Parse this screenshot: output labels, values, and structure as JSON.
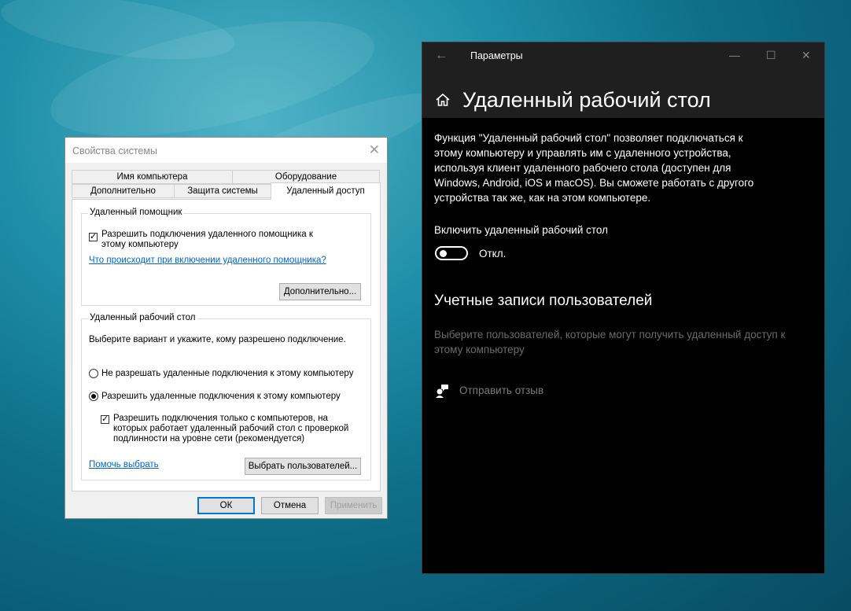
{
  "dialog": {
    "title": "Свойства системы",
    "tabs_row1": [
      "Имя компьютера",
      "Оборудование"
    ],
    "tabs_row2": [
      "Дополнительно",
      "Защита системы",
      "Удаленный доступ"
    ],
    "remote_assistance": {
      "group_title": "Удаленный помощник",
      "allow_checkbox_label": "Разрешить подключения удаленного помощника к этому компьютеру",
      "allow_checked": true,
      "help_link": "Что происходит при включении удаленного помощника?",
      "advanced_button": "Дополнительно..."
    },
    "remote_desktop": {
      "group_title": "Удаленный рабочий стол",
      "instruction": "Выберите вариант и укажите, кому разрешено подключение.",
      "option_deny": "Не разрешать удаленные подключения к этому компьютеру",
      "option_allow": "Разрешить удаленные подключения к этому компьютеру",
      "selected_option": "allow",
      "nla_checkbox_label": "Разрешить подключения только с компьютеров, на которых работает удаленный рабочий стол с проверкой подлинности на уровне сети (рекомендуется)",
      "nla_checked": true,
      "help_link": "Помочь выбрать",
      "select_users_button": "Выбрать пользователей..."
    },
    "buttons": {
      "ok": "ОК",
      "cancel": "Отмена",
      "apply": "Применить"
    }
  },
  "settings": {
    "window_title": "Параметры",
    "heading": "Удаленный рабочий стол",
    "description": "Функция \"Удаленный рабочий стол\" позволяет подключаться к этому компьютеру и управлять им с удаленного устройства, используя клиент удаленного рабочего стола (доступен для Windows, Android, iOS и macOS). Вы сможете работать с другого устройства так же, как на этом компьютере.",
    "toggle_label": "Включить удаленный рабочий стол",
    "toggle_state": "Откл.",
    "toggle_on": false,
    "accounts_heading": "Учетные записи пользователей",
    "accounts_description": "Выберите пользователей, которые могут получить удаленный доступ к этому компьютеру",
    "feedback_link": "Отправить отзыв"
  },
  "colors": {
    "link_blue": "#0066cc",
    "settings_bg": "#000000",
    "settings_header_bg": "#1f1f1f",
    "disabled_text": "#6b6b6b"
  }
}
